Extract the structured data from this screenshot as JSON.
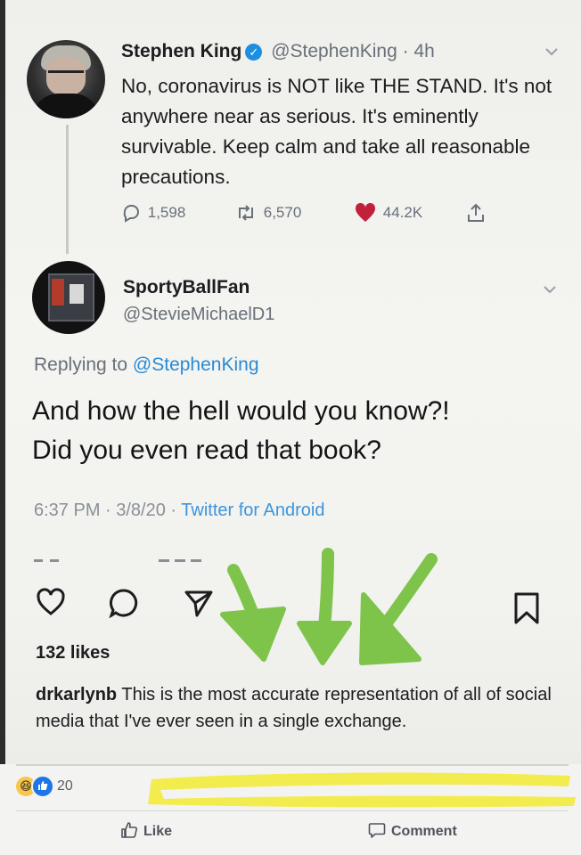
{
  "tweet1": {
    "name": "Stephen King",
    "handle": "@StephenKing",
    "separator": "·",
    "time": "4h",
    "text": "No, coronavirus is NOT like THE STAND. It's not anywhere near as serious. It's eminently survivable. Keep calm and take all reasonable precautions.",
    "replies": "1,598",
    "retweets": "6,570",
    "likes": "44.2K"
  },
  "tweet2": {
    "name": "SportyBallFan",
    "handle": "@StevieMichaelD1",
    "replying_prefix": "Replying to",
    "replying_to": "@StephenKing",
    "text_line1": "And how the hell would you know?!",
    "text_line2": "Did you even read that book?",
    "timestamp": "6:37 PM · 3/8/20 ·",
    "source": "Twitter for Android"
  },
  "instagram": {
    "likes_label": "132 likes",
    "caption_user": "drkarlynb",
    "caption_text": "This is the most accurate representation of all of social media that I've ever seen in a single exchange."
  },
  "facebook": {
    "reaction_count": "20",
    "like_label": "Like",
    "comment_label": "Comment"
  },
  "colors": {
    "link_blue": "#2a8ad6",
    "verified_blue": "#1d8fe0",
    "heart_red": "#c1213a",
    "arrow_green": "#7ec44a",
    "redaction_yellow": "#f3ec4e"
  }
}
